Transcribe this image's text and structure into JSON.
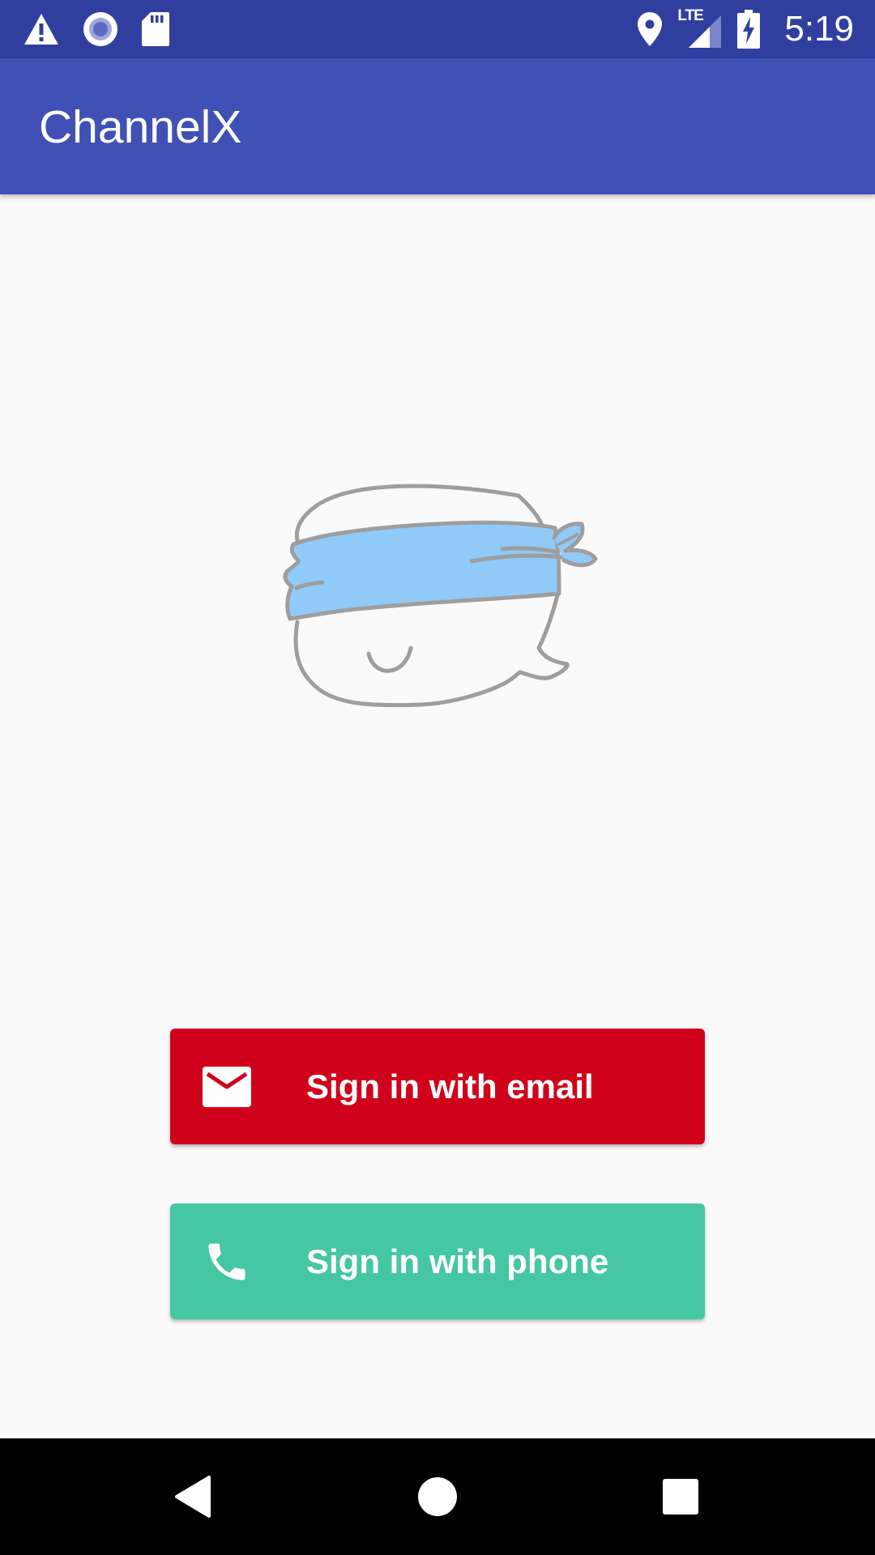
{
  "status_bar": {
    "time": "5:19",
    "network_type": "LTE",
    "icons": [
      "warning-icon",
      "sync-circle-icon",
      "sd-card-icon",
      "location-icon",
      "signal-icon",
      "battery-charging-icon"
    ]
  },
  "app_bar": {
    "title": "ChannelX"
  },
  "illustration": {
    "icon": "blindfolded-face-illustration"
  },
  "buttons": {
    "email": {
      "label": "Sign in with email",
      "icon": "mail-icon",
      "color": "#d0021b"
    },
    "phone": {
      "label": "Sign in with phone",
      "icon": "phone-icon",
      "color": "#45c6a5"
    }
  },
  "nav_bar": {
    "items": [
      "back-icon",
      "home-icon",
      "recents-icon"
    ]
  },
  "colors": {
    "status_bar": "#303f9f",
    "app_bar": "#3f51b5",
    "background": "#fafafa",
    "blindfold": "#90caf9",
    "outline": "#9e9e9e"
  }
}
